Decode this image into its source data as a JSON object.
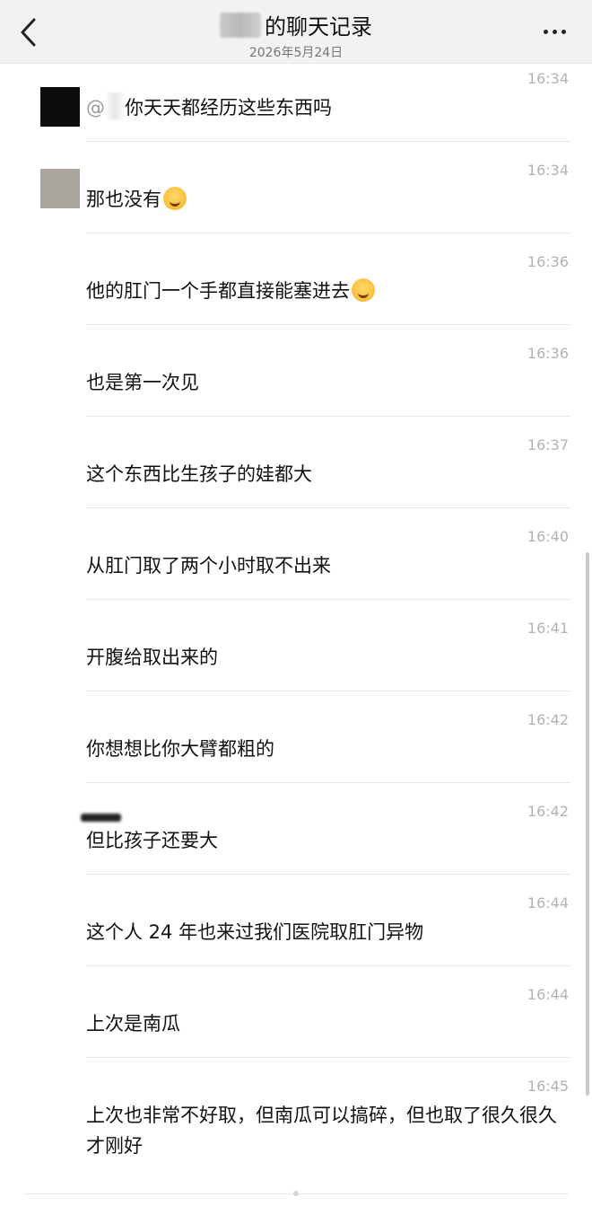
{
  "header": {
    "title": "的聊天记录",
    "date": "2026年5月24日"
  },
  "messages": [
    {
      "time": "16:34",
      "text": "你天天都经历这些东西吗"
    },
    {
      "time": "16:34",
      "text": "那也没有"
    },
    {
      "time": "16:36",
      "text": "他的肛门一个手都直接能塞进去"
    },
    {
      "time": "16:36",
      "text": "也是第一次见"
    },
    {
      "time": "16:37",
      "text": "这个东西比生孩子的娃都大"
    },
    {
      "time": "16:40",
      "text": "从肛门取了两个小时取不出来"
    },
    {
      "time": "16:41",
      "text": "开腹给取出来的"
    },
    {
      "time": "16:42",
      "text": "你想想比你大臂都粗的"
    },
    {
      "time": "16:42",
      "text": "但比孩子还要大"
    },
    {
      "time": "16:44",
      "text": "这个人 24 年也来过我们医院取肛门异物"
    },
    {
      "time": "16:44",
      "text": "上次是南瓜"
    },
    {
      "time": "16:45",
      "text": "上次也非常不好取，但南瓜可以搞碎，但也取了很久很久才刚好"
    }
  ]
}
